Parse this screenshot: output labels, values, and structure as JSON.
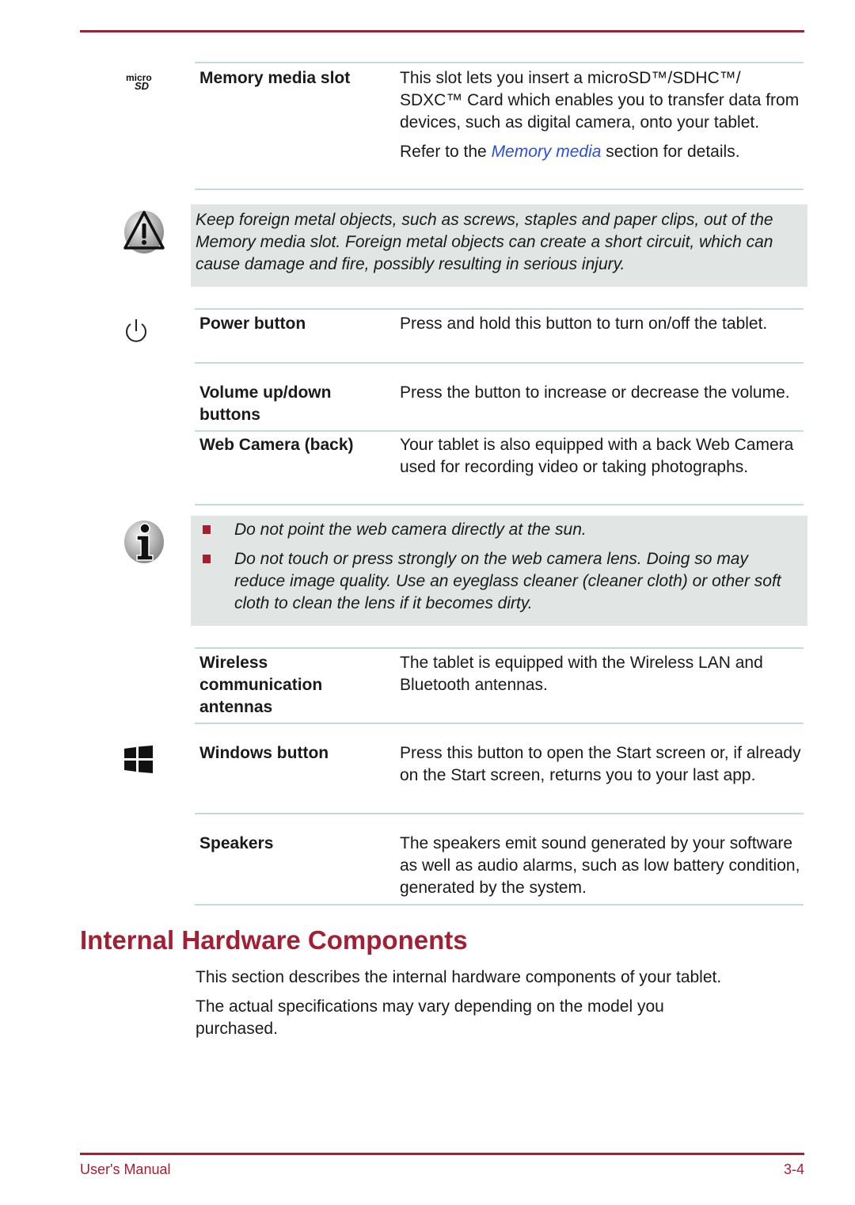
{
  "footer": {
    "left": "User's Manual",
    "right": "3-4"
  },
  "rows_top": [
    {
      "icon": "microsd-icon",
      "term": "Memory media slot",
      "desc": "This slot lets you insert a microSD™/SDHC™/ SDXC™ Card which enables you to transfer data from devices, such as digital camera, onto your tablet.",
      "ref_before": "Refer to the ",
      "ref_link": "Memory media",
      "ref_after": " section for details."
    }
  ],
  "warning": {
    "icon": "warning-icon",
    "text": "Keep foreign metal objects, such as screws, staples and paper clips, out of the Memory media slot. Foreign metal objects can create a short circuit, which can cause damage and fire, possibly resulting in serious injury."
  },
  "rows_mid": [
    {
      "icon": "power-icon",
      "term": "Power button",
      "desc": "Press and hold this button to turn on/off the tablet."
    },
    {
      "term": "Volume up/down buttons",
      "desc": "Press the button to increase or decrease the volume."
    },
    {
      "term": "Web Camera (back)",
      "desc": "Your tablet is also equipped with a back Web Camera used for recording video or taking photographs."
    }
  ],
  "note": {
    "icon": "info-icon",
    "items": [
      "Do not point the web camera directly at the sun.",
      "Do not touch or press strongly on the web camera lens. Doing so may reduce image quality. Use an eyeglass cleaner (cleaner cloth) or other soft cloth to clean the lens if it becomes dirty."
    ]
  },
  "rows_bottom": [
    {
      "term": "Wireless communication antennas",
      "desc": "The tablet is equipped with the Wireless LAN and Bluetooth antennas."
    },
    {
      "icon": "windows-icon",
      "term": "Windows button",
      "desc": "Press this button to open the Start screen or, if already on the Start screen, returns you to your last app."
    },
    {
      "term": "Speakers",
      "desc": "The speakers emit sound generated by your software as well as audio alarms, such as low battery condition, generated by the system."
    }
  ],
  "section": {
    "title": "Internal Hardware Components",
    "paragraphs": [
      "This section describes the internal hardware components of your tablet.",
      "The actual specifications may vary depending on the model you purchased."
    ]
  },
  "colors": {
    "accent": "#a31f34",
    "callout_bg": "#e1e5e4",
    "table_rule": "#c4dcd9",
    "link": "#2a4fd6"
  }
}
